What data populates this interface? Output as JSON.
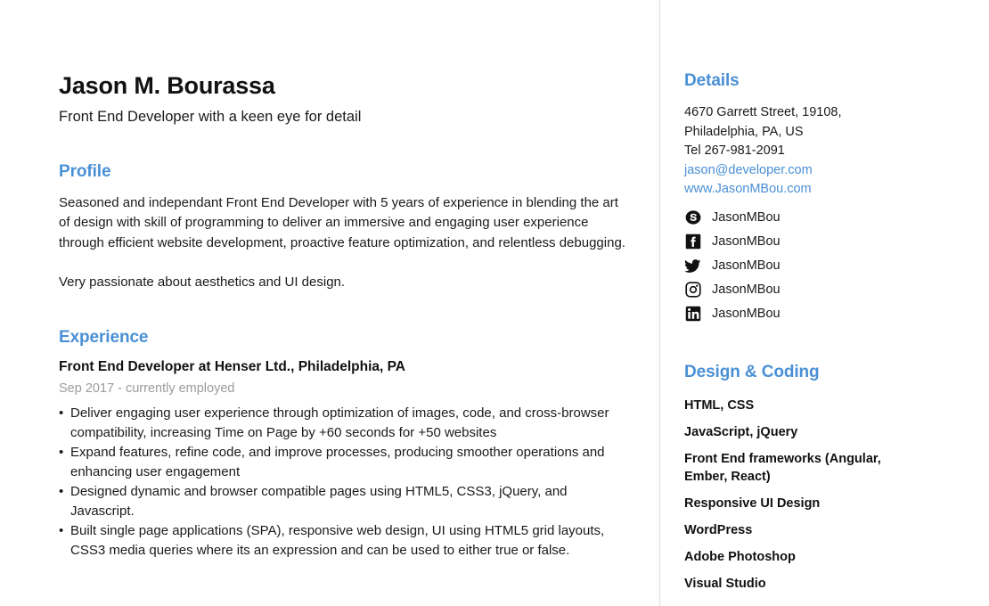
{
  "header": {
    "name": "Jason M. Bourassa",
    "tagline": "Front End Developer with a keen eye for detail"
  },
  "profile": {
    "heading": "Profile",
    "paragraphs": [
      "Seasoned and independant Front End Developer with 5 years of experience in blending the art of design with skill of programming to deliver an immersive and engaging user experience through efficient website development, proactive feature optimization, and relentless debugging.",
      "Very passionate about aesthetics and UI design."
    ]
  },
  "experience": {
    "heading": "Experience",
    "jobs": [
      {
        "title": "Front End Developer at Henser Ltd., Philadelphia, PA",
        "dates": "Sep 2017 - currently employed",
        "bullet_marker": "•",
        "bullets": [
          "Deliver engaging user experience through optimization of images, code, and cross-browser compatibility, increasing Time on Page by +60 seconds for +50 websites",
          "Expand features, refine code, and improve processes, producing smoother operations and enhancing user engagement",
          "Designed dynamic and browser compatible pages using HTML5, CSS3, jQuery, and Javascript.",
          "Built single page applications (SPA), responsive web design, UI using HTML5 grid layouts, CSS3 media queries where its an expression and can be used to either true or false."
        ]
      }
    ]
  },
  "details": {
    "heading": "Details",
    "address_line_1": "4670 Garrett Street, 19108,",
    "address_line_2": "Philadelphia, PA, US",
    "phone": "Tel 267-981-2091",
    "email": "jason@developer.com",
    "website": "www.JasonMBou.com",
    "socials": [
      {
        "icon": "skype-icon",
        "handle": "JasonMBou"
      },
      {
        "icon": "facebook-icon",
        "handle": "JasonMBou"
      },
      {
        "icon": "twitter-icon",
        "handle": "JasonMBou"
      },
      {
        "icon": "instagram-icon",
        "handle": "JasonMBou"
      },
      {
        "icon": "linkedin-icon",
        "handle": "JasonMBou"
      }
    ]
  },
  "skills": {
    "heading": "Design & Coding",
    "items": [
      "HTML, CSS",
      "JavaScript, jQuery",
      "Front End frameworks (Angular, Ember, React)",
      "Responsive UI Design",
      "WordPress",
      "Adobe Photoshop",
      "Visual Studio"
    ]
  },
  "colors": {
    "accent": "#4a90d6",
    "text": "#1a1a1a",
    "muted": "#9b9b9b",
    "divider": "#dcdcdc",
    "icon": "#111111"
  }
}
